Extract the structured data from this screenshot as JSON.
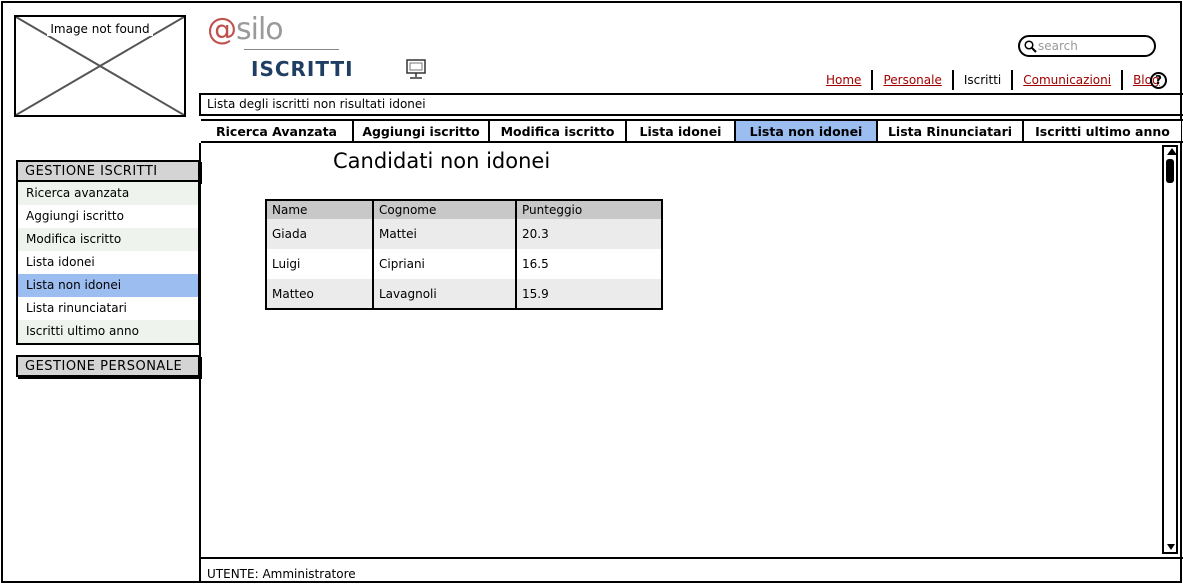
{
  "image_placeholder": {
    "label": "Image not found"
  },
  "logo": {
    "at": "@",
    "rest": "silo"
  },
  "page_heading": "ISCRITTI",
  "search": {
    "placeholder": "search"
  },
  "top_links": [
    {
      "label": "Home"
    },
    {
      "label": "Personale"
    },
    {
      "label": "Iscritti"
    },
    {
      "label": "Comunicazioni"
    },
    {
      "label": "Blog"
    }
  ],
  "subtitle": "Lista degli iscritti non risultati idonei",
  "tabs": [
    {
      "label": "Ricerca Avanzata"
    },
    {
      "label": "Aggiungi iscritto"
    },
    {
      "label": "Modifica iscritto"
    },
    {
      "label": "Lista idonei"
    },
    {
      "label": "Lista non idonei"
    },
    {
      "label": "Lista Rinunciatari"
    },
    {
      "label": "Iscritti ultimo anno"
    }
  ],
  "content_title": "Candidati non idonei",
  "table": {
    "headers": [
      "Name",
      "Cognome",
      "Punteggio"
    ],
    "rows": [
      [
        "Giada",
        "Mattei",
        "20.3"
      ],
      [
        "Luigi",
        "Cipriani",
        "16.5"
      ],
      [
        "Matteo",
        "Lavagnoli",
        "15.9"
      ]
    ]
  },
  "sidebar": {
    "section1": {
      "title": "GESTIONE ISCRITTI",
      "items": [
        {
          "label": "Ricerca avanzata"
        },
        {
          "label": "Aggiungi iscritto"
        },
        {
          "label": "Modifica iscritto"
        },
        {
          "label": "Lista idonei"
        },
        {
          "label": "Lista non idonei"
        },
        {
          "label": "Lista rinunciatari"
        },
        {
          "label": "Iscritti ultimo anno"
        }
      ]
    },
    "section2": {
      "title": "GESTIONE PERSONALE"
    }
  },
  "footer": "UTENTE: Amministratore",
  "colors": {
    "active": "#9cbdf0",
    "link": "#a00000",
    "logo_at": "#c0504d",
    "heading": "#1f3e63"
  },
  "icons": {
    "search": "search-icon",
    "help": "help-icon",
    "monitor": "monitor-icon"
  }
}
